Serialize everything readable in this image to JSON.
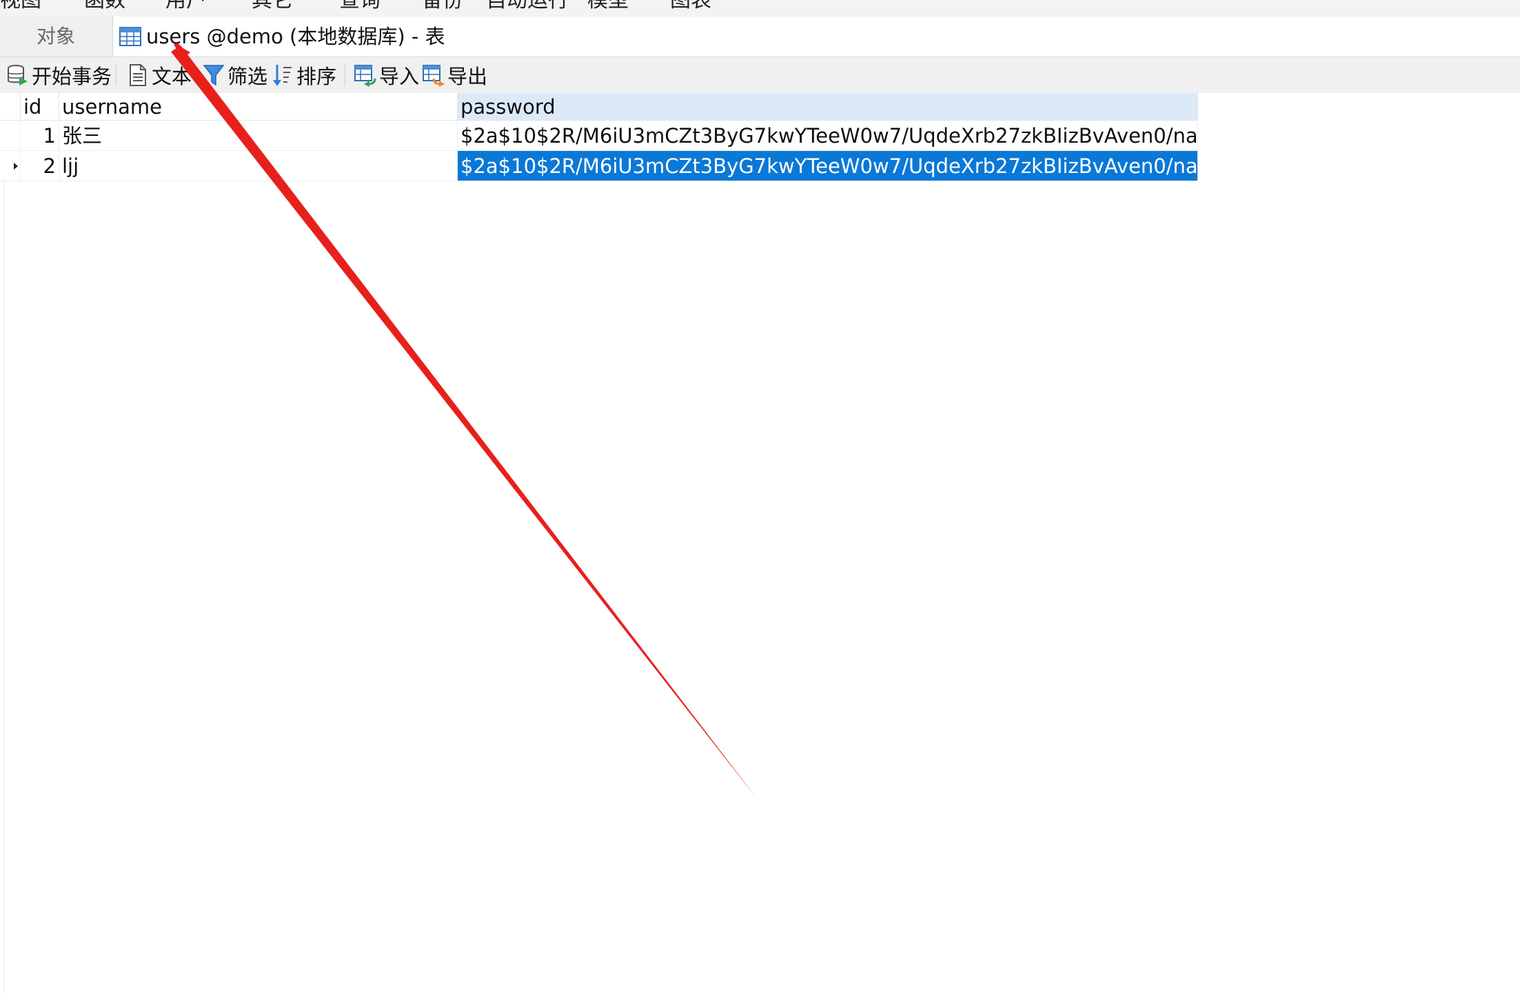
{
  "menubar": {
    "items": [
      "视图",
      "函数",
      "用户",
      "其它",
      "查询",
      "备份",
      "自动运行",
      "模型",
      "图表"
    ]
  },
  "tabs": {
    "objects_label": "对象",
    "active_label": "users @demo (本地数据库) - 表"
  },
  "toolbar": {
    "begin_transaction": "开始事务",
    "text": "文本",
    "filter": "筛选",
    "sort": "排序",
    "import": "导入",
    "export": "导出"
  },
  "grid": {
    "columns": [
      "id",
      "username",
      "password"
    ],
    "rows": [
      {
        "id": "1",
        "username": "张三",
        "password": "$2a$10$2R/M6iU3mCZt3ByG7kwYTeeW0w7/UqdeXrb27zkBIizBvAven0/na"
      },
      {
        "id": "2",
        "username": "ljj",
        "password": "$2a$10$2R/M6iU3mCZt3ByG7kwYTeeW0w7/UqdeXrb27zkBIizBvAven0/na"
      }
    ]
  },
  "colors": {
    "selection": "#0a78d7",
    "header_selected": "#dceaf8",
    "annotation_arrow": "#e8201c"
  }
}
